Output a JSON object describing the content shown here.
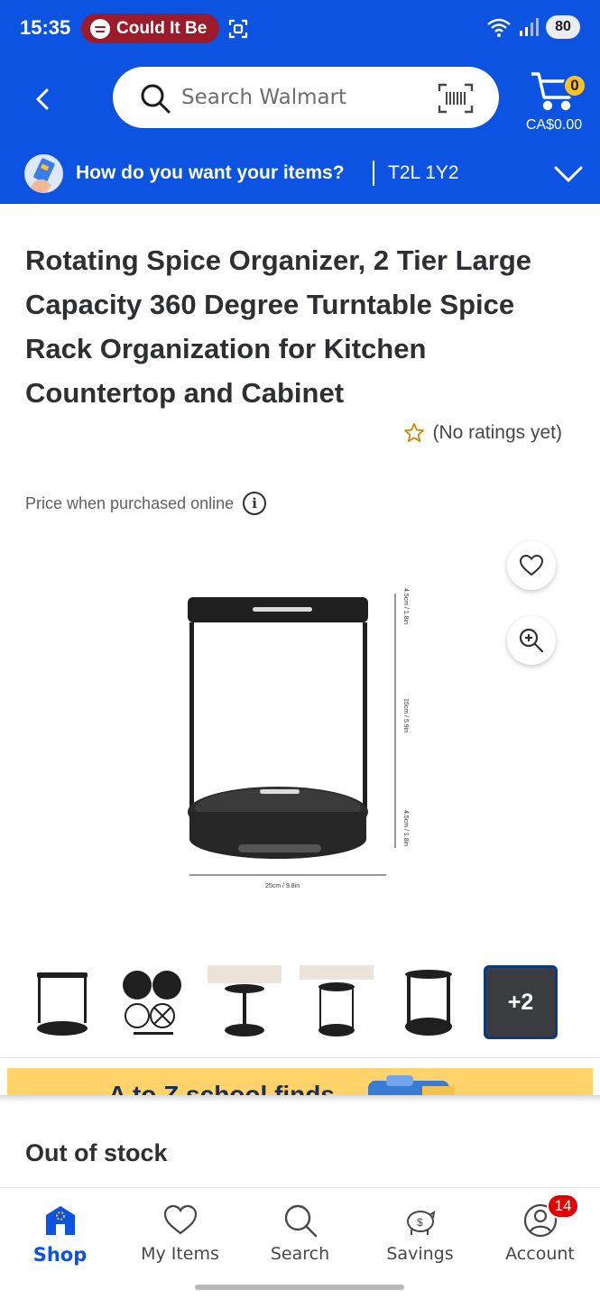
{
  "status_bar": {
    "time": "15:35",
    "media_pill": "Could It Be",
    "battery": "80"
  },
  "header": {
    "search_placeholder": "Search Walmart",
    "cart_count": "0",
    "cart_total": "CA$0.00",
    "delivery_question": "How do you want your items?",
    "postal_code": "T2L 1Y2"
  },
  "product": {
    "title": "Rotating Spice Organizer, 2 Tier Large Capacity 360 Degree Turntable Spice Rack Organization for Kitchen Countertop and Cabinet",
    "ratings": "(No ratings yet)",
    "price_note": "Price when purchased online",
    "dimensions": {
      "top_rim": "4.5cm / 1.8in",
      "middle": "15cm / 5.9in",
      "bottom_rim": "4.5cm / 1.8in",
      "width": "25cm / 9.8in"
    },
    "thumbnails_more": "+2",
    "stock_status": "Out of stock"
  },
  "promo": {
    "text": "A to Z school finds"
  },
  "bottom_nav": {
    "items": [
      {
        "label": "Shop",
        "icon": "shop-icon",
        "active": true
      },
      {
        "label": "My Items",
        "icon": "heart-icon",
        "active": false
      },
      {
        "label": "Search",
        "icon": "search-icon",
        "active": false
      },
      {
        "label": "Savings",
        "icon": "piggy-bank-icon",
        "active": false
      },
      {
        "label": "Account",
        "icon": "account-icon",
        "active": false
      }
    ],
    "account_badge": "14"
  },
  "colors": {
    "brand_blue": "#0b53e0",
    "spark_yellow": "#ffc220",
    "badge_red": "#e30000",
    "pill_red": "#9b1b2a"
  }
}
